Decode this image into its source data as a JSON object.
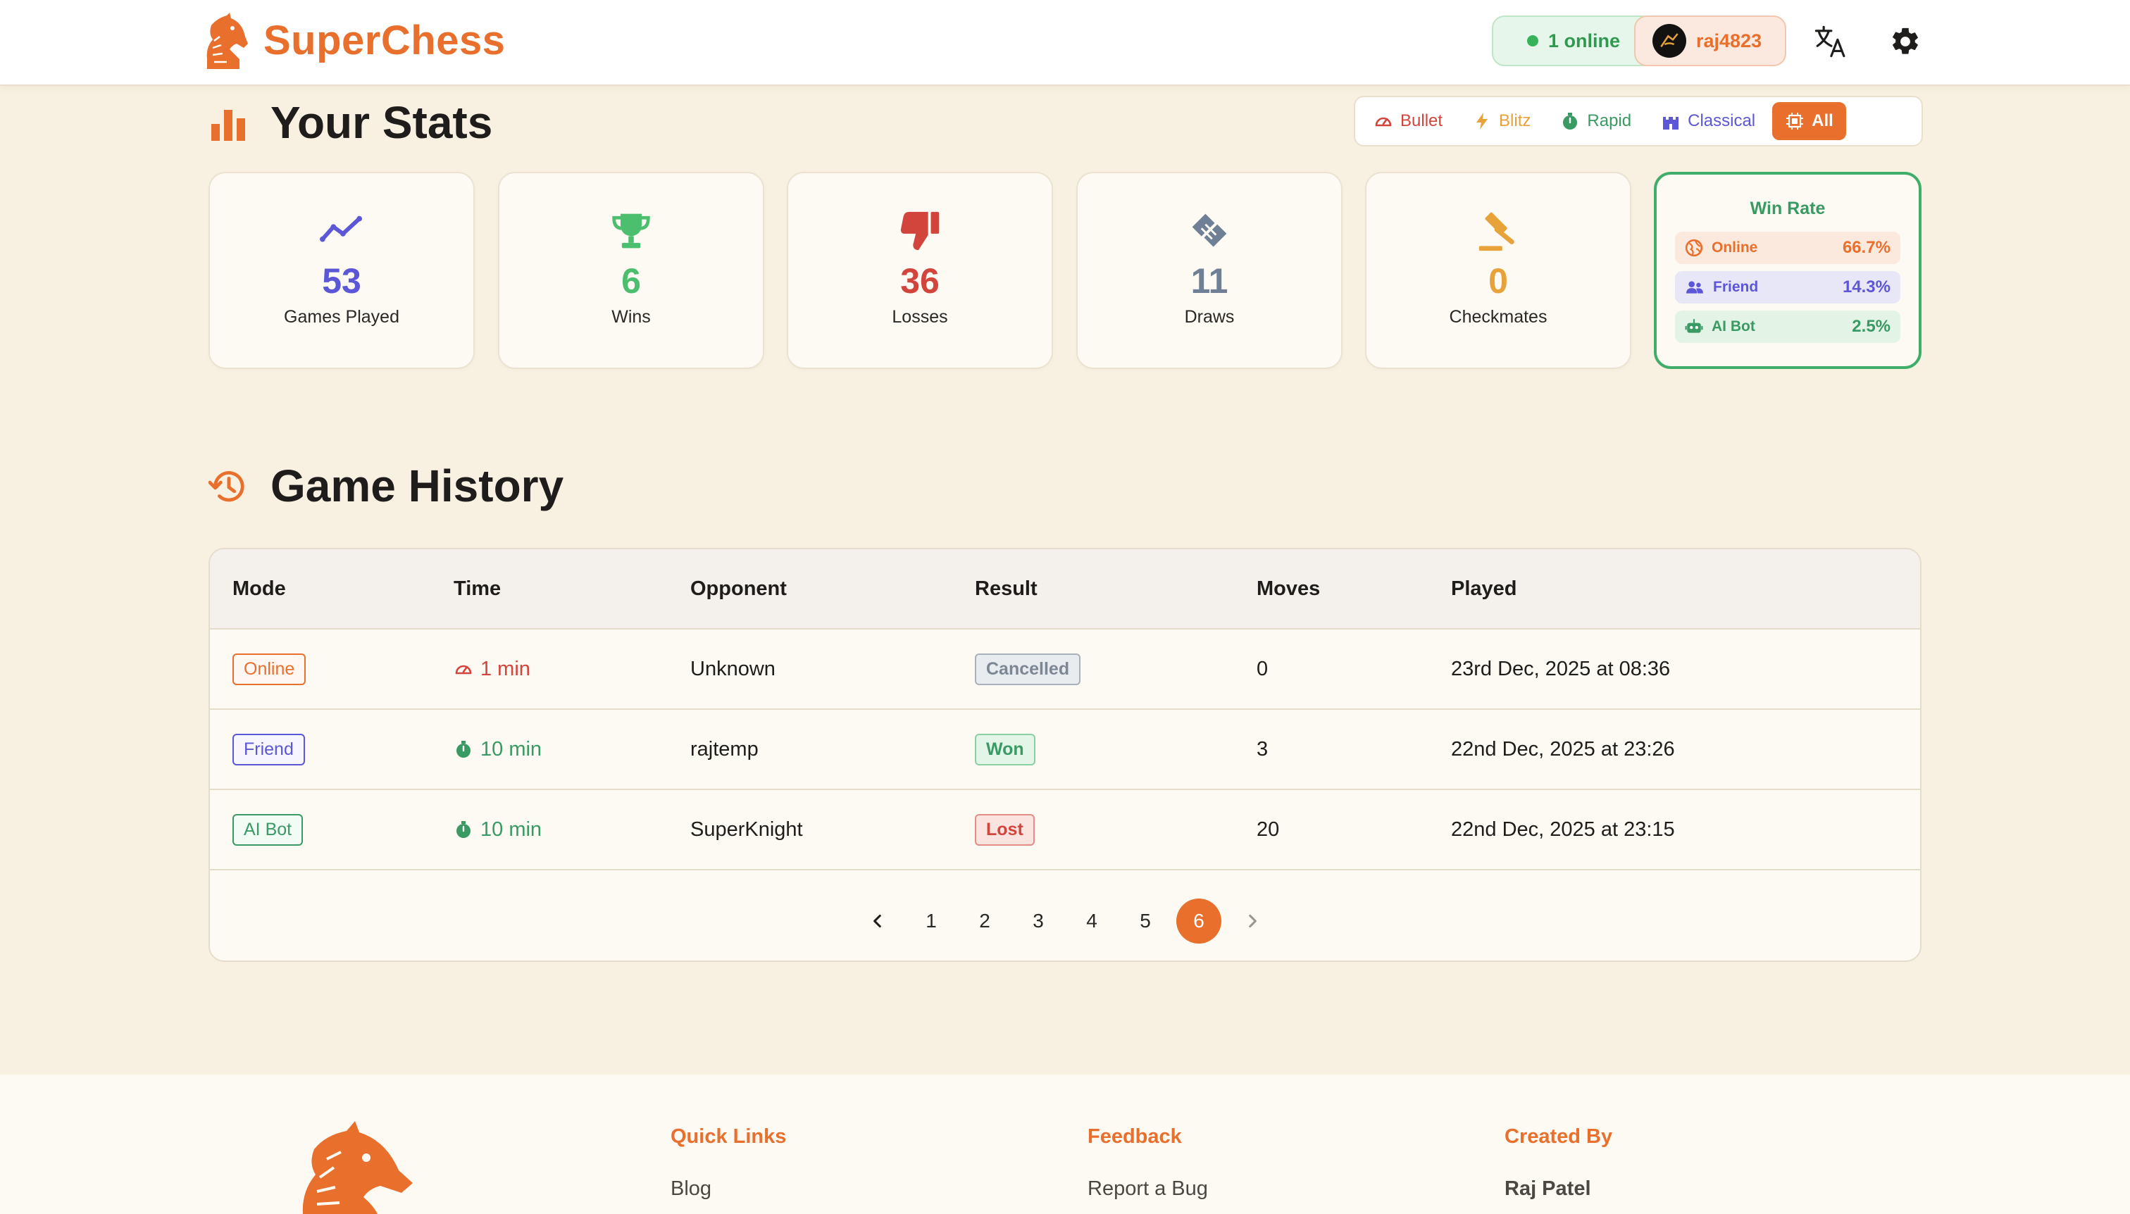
{
  "header": {
    "brand": "SuperChess",
    "online": "1 online",
    "username": "raj4823"
  },
  "stats": {
    "title": "Your Stats",
    "filters": [
      {
        "label": "Bullet",
        "color": "#d2453d"
      },
      {
        "label": "Blitz",
        "color": "#e8a23a"
      },
      {
        "label": "Rapid",
        "color": "#3a9a63"
      },
      {
        "label": "Classical",
        "color": "#5b57d6"
      },
      {
        "label": "All",
        "active": true
      }
    ],
    "cards": [
      {
        "value": "53",
        "label": "Games Played",
        "icon": "trend-line-icon",
        "color": "#5b57d6"
      },
      {
        "value": "6",
        "label": "Wins",
        "icon": "trophy-icon",
        "color": "#4cbf6e"
      },
      {
        "value": "36",
        "label": "Losses",
        "icon": "thumbs-down-icon",
        "color": "#d2453d"
      },
      {
        "value": "11",
        "label": "Draws",
        "icon": "handshake-icon",
        "color": "#6f7f95"
      },
      {
        "value": "0",
        "label": "Checkmates",
        "icon": "gavel-icon",
        "color": "#e8a23a"
      }
    ],
    "win_rate": {
      "title": "Win Rate",
      "rows": [
        {
          "label": "Online",
          "value": "66.7%"
        },
        {
          "label": "Friend",
          "value": "14.3%"
        },
        {
          "label": "AI Bot",
          "value": "2.5%"
        }
      ]
    }
  },
  "history": {
    "title": "Game History",
    "columns": [
      "Mode",
      "Time",
      "Opponent",
      "Result",
      "Moves",
      "Played"
    ],
    "rows": [
      {
        "mode": "Online",
        "time": "1 min",
        "opponent": "Unknown",
        "result": "Cancelled",
        "moves": "0",
        "played": "23rd Dec, 2025 at 08:36"
      },
      {
        "mode": "Friend",
        "time": "10 min",
        "opponent": "rajtemp",
        "result": "Won",
        "moves": "3",
        "played": "22nd Dec, 2025 at 23:26"
      },
      {
        "mode": "AI Bot",
        "time": "10 min",
        "opponent": "SuperKnight",
        "result": "Lost",
        "moves": "20",
        "played": "22nd Dec, 2025 at 23:15"
      }
    ],
    "pages": [
      "1",
      "2",
      "3",
      "4",
      "5",
      "6"
    ],
    "current_page": "6"
  },
  "footer": {
    "quick_links_title": "Quick Links",
    "quick_link_1": "Blog",
    "feedback_title": "Feedback",
    "feedback_link_1": "Report a Bug",
    "created_by_title": "Created By",
    "author": "Raj Patel"
  }
}
